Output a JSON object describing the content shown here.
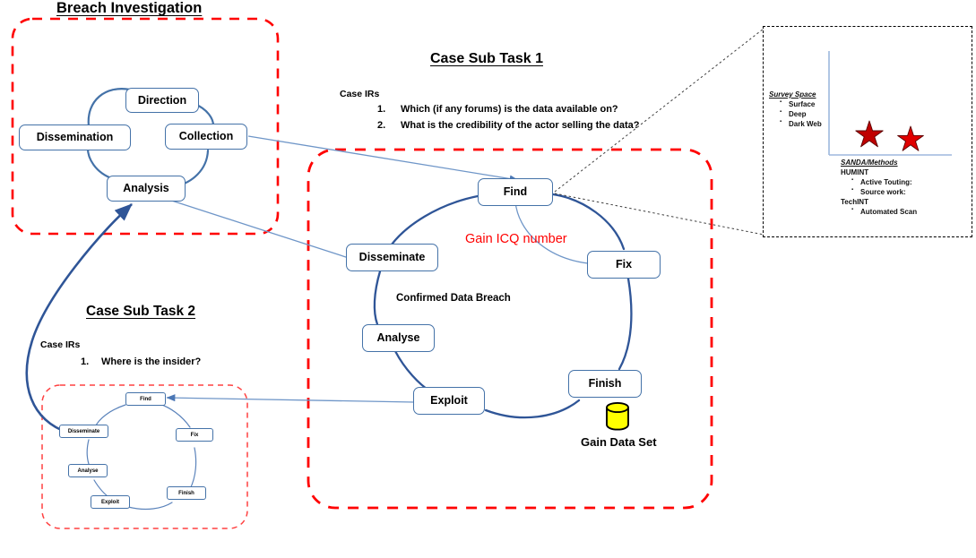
{
  "sections": {
    "breach": {
      "title": "Breach Investigation",
      "nodes": [
        {
          "label": "Direction"
        },
        {
          "label": "Collection"
        },
        {
          "label": "Dissemination"
        },
        {
          "label": "Analysis"
        }
      ]
    },
    "subtask1": {
      "title": "Case Sub Task 1",
      "irs_heading": "Case IRs",
      "irs": [
        {
          "num": "1.",
          "text": "Which (if any forums) is the data available on?"
        },
        {
          "num": "2.",
          "text": "What is the credibility of the actor selling the data?"
        }
      ],
      "nodes": [
        {
          "label": "Find"
        },
        {
          "label": "Fix"
        },
        {
          "label": "Finish"
        },
        {
          "label": "Exploit"
        },
        {
          "label": "Analyse"
        },
        {
          "label": "Disseminate"
        }
      ],
      "annotations": {
        "gain_icq": "Gain ICQ number",
        "confirmed_breach": "Confirmed Data Breach",
        "gain_data_set": "Gain Data Set"
      }
    },
    "subtask2": {
      "title": "Case Sub Task 2",
      "irs_heading": "Case IRs",
      "irs": [
        {
          "num": "1.",
          "text": "Where is the insider?"
        }
      ],
      "nodes": [
        {
          "label": "Find"
        },
        {
          "label": "Fix"
        },
        {
          "label": "Finish"
        },
        {
          "label": "Exploit"
        },
        {
          "label": "Analyse"
        },
        {
          "label": "Disseminate"
        }
      ]
    },
    "detail_panel": {
      "survey": {
        "heading": "Survey Space",
        "items": [
          "Surface",
          "Deep",
          "Dark Web"
        ]
      },
      "methods": {
        "heading": "SANDA/Methods",
        "group1": "HUMINT",
        "group1_items": [
          "Active Touting:",
          "Source work:"
        ],
        "group2": "TechINT",
        "group2_items": [
          "Automated Scan"
        ]
      },
      "markers": [
        "star",
        "star"
      ]
    }
  },
  "colors": {
    "node_border": "#4472a8",
    "flow_arrow": "#2f5597",
    "thin_arrow": "#6f96c8",
    "dashed_group": "#ff0000",
    "callout": "#3f3f3f",
    "annotation_red": "#ff0000",
    "database_fill": "#ffff00",
    "star_fill": "#c00000",
    "panel_axis": "#9db7dd"
  }
}
